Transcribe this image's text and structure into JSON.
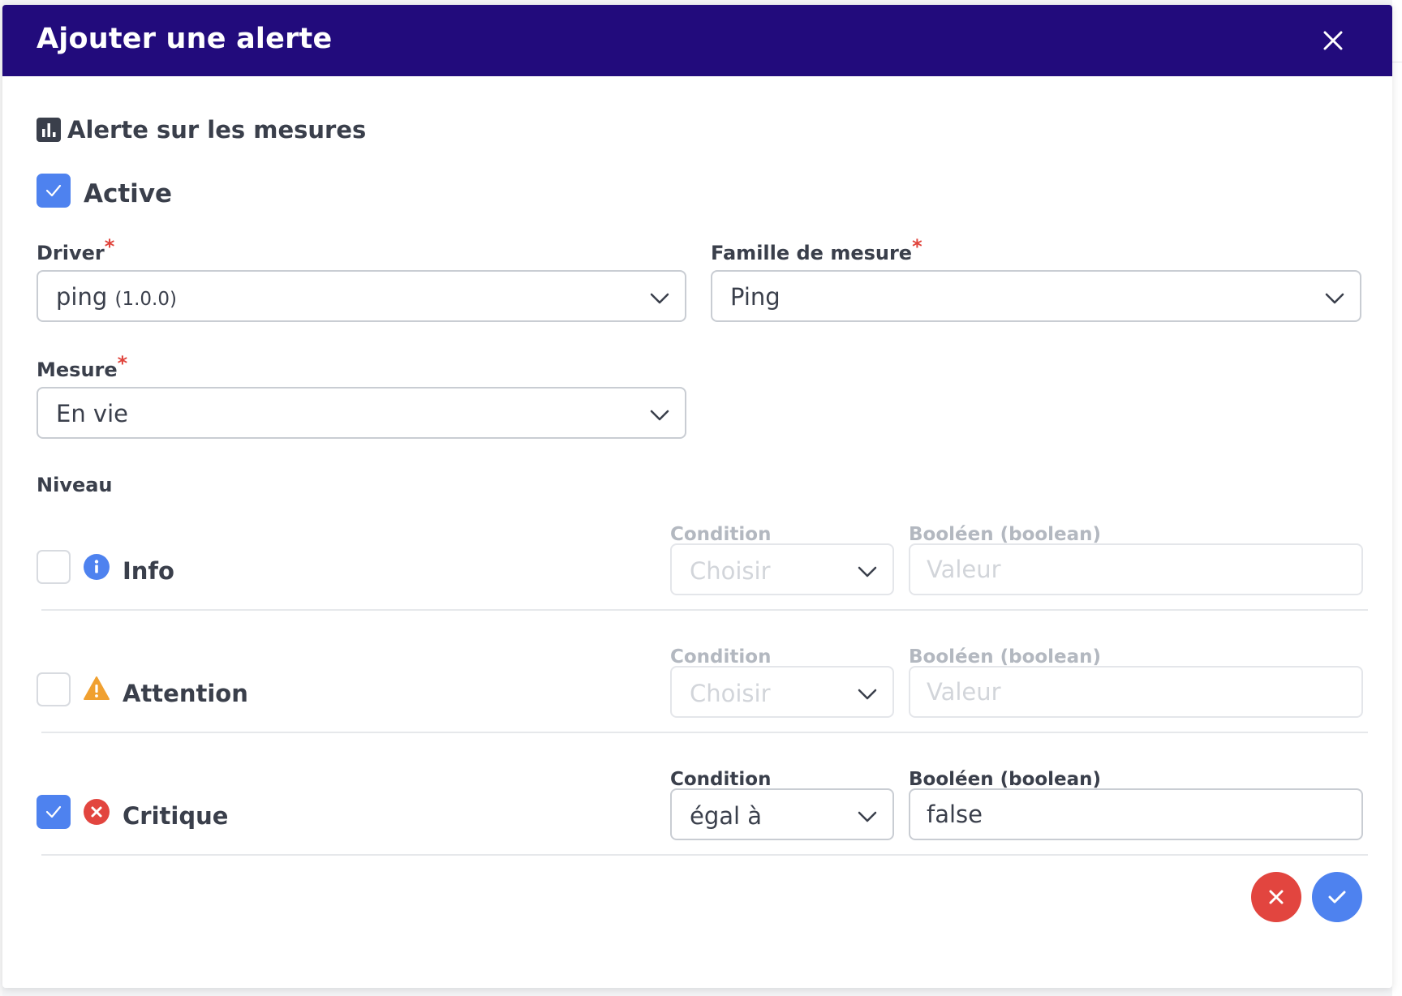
{
  "modal": {
    "title": "Ajouter une alerte",
    "close_icon": "close-icon"
  },
  "section": {
    "title": "Alerte sur les mesures",
    "icon": "bar-chart-icon"
  },
  "active": {
    "label": "Active",
    "checked": true
  },
  "fields": {
    "driver": {
      "label": "Driver",
      "required": "*",
      "value": "ping",
      "version": "(1.0.0)"
    },
    "famille": {
      "label": "Famille de mesure",
      "required": "*",
      "value": "Ping"
    },
    "mesure": {
      "label": "Mesure",
      "required": "*",
      "value": "En vie"
    }
  },
  "niveau": {
    "label": "Niveau",
    "levels": [
      {
        "name": "Info",
        "icon": "info-icon",
        "checked": false,
        "condition_label": "Condition",
        "condition_value": "Choisir",
        "value_label": "Booléen (boolean)",
        "value_placeholder": "Valeur",
        "value": ""
      },
      {
        "name": "Attention",
        "icon": "warning-icon",
        "checked": false,
        "condition_label": "Condition",
        "condition_value": "Choisir",
        "value_label": "Booléen (boolean)",
        "value_placeholder": "Valeur",
        "value": ""
      },
      {
        "name": "Critique",
        "icon": "error-icon",
        "checked": true,
        "condition_label": "Condition",
        "condition_value": "égal à",
        "value_label": "Booléen (boolean)",
        "value_placeholder": "Valeur",
        "value": "false"
      }
    ]
  },
  "actions": {
    "cancel_icon": "close-icon",
    "confirm_icon": "check-icon"
  },
  "colors": {
    "header": "#220b7c",
    "accent": "#4e82ef",
    "danger": "#e2453f",
    "warning": "#f0a030"
  }
}
